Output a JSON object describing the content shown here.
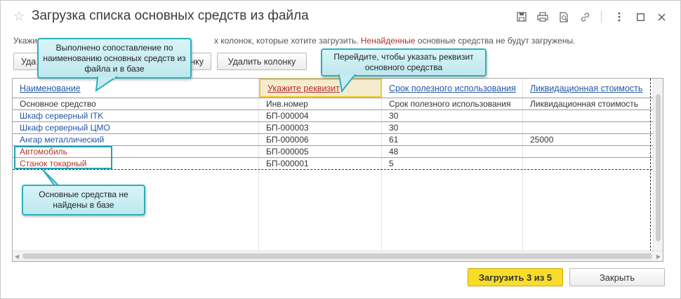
{
  "window": {
    "title": "Загрузка списка основных средств из файла",
    "star": "☆"
  },
  "hint": {
    "prefix": "Укажи",
    "middle": "х колонок, которые хотите загрузить. ",
    "not_found": "Ненайденные",
    "suffix": " основные средства не будут загружены."
  },
  "toolbar": {
    "map_button_label": "Уда",
    "map_button_tail": "нку",
    "delete_column_label": "Удалить колонку"
  },
  "table": {
    "headers": [
      "Наименование",
      "Укажите реквизит",
      "Срок полезного использования",
      "Ликвидационная стоимость"
    ],
    "subheaders": [
      "Основное средство",
      "Инв.номер",
      "Срок полезного использования",
      "Ликвидационная стоимость"
    ],
    "rows": [
      {
        "name": "Шкаф серверный ITK",
        "inv": "БП-000004",
        "term": "30",
        "liq": "",
        "found": true
      },
      {
        "name": "Шкаф серверный ЦМО",
        "inv": "БП-000003",
        "term": "30",
        "liq": "",
        "found": true
      },
      {
        "name": "Ангар металлический",
        "inv": "БП-000006",
        "term": "61",
        "liq": "25000",
        "found": true
      },
      {
        "name": "Автомобиль",
        "inv": "БП-000005",
        "term": "48",
        "liq": "",
        "found": false
      },
      {
        "name": "Станок токарный",
        "inv": "БП-000001",
        "term": "5",
        "liq": "",
        "found": false
      }
    ]
  },
  "callouts": {
    "matched": "Выполнено сопоставление по наименованию основных средств из файла и в базе",
    "requisite": "Перейдите, чтобы указать реквизит основного средства",
    "not_found": "Основные средства не найдены в базе"
  },
  "footer": {
    "load_label": "Загрузить 3 из 5",
    "close_label": "Закрыть"
  },
  "colors": {
    "link_blue": "#2457a8",
    "not_found_red": "#b4332c",
    "accent_yellow": "#f8dc2a",
    "callout_teal": "#2ab0bd"
  }
}
